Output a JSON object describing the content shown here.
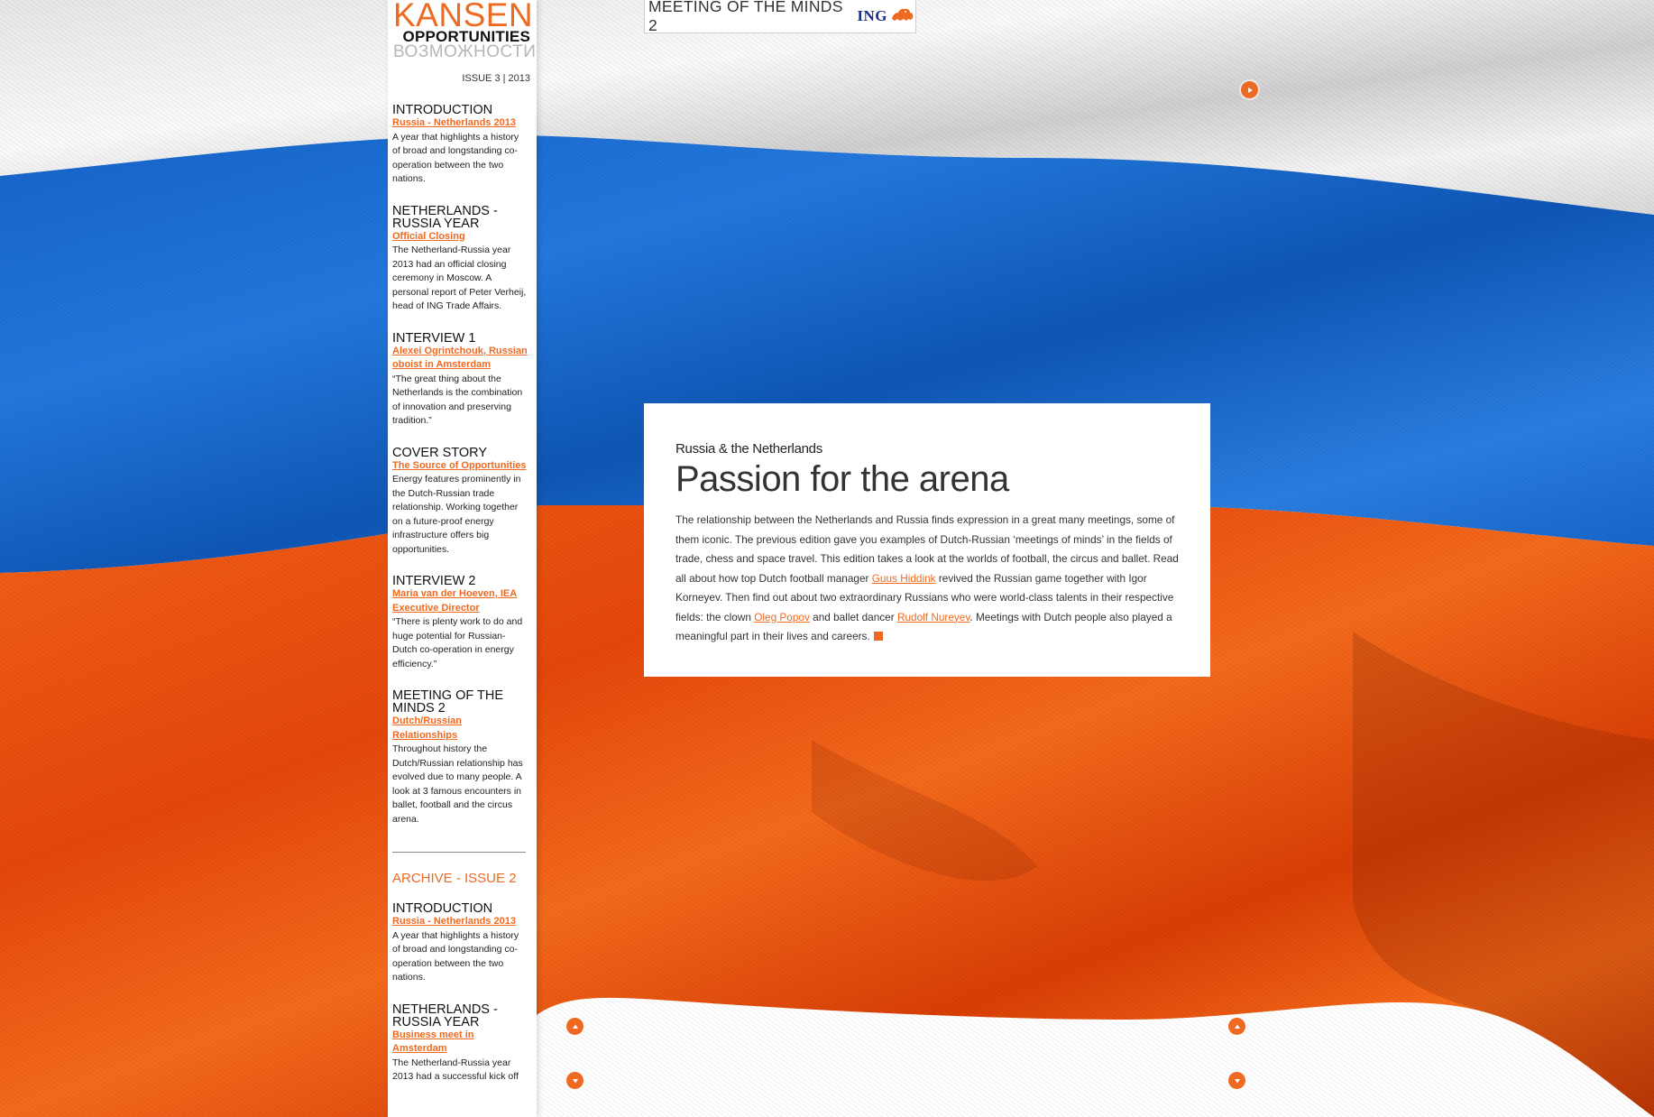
{
  "masthead": {
    "title_nl": "KANSEN",
    "title_en": "OPPORTUNITIES",
    "title_ru": "ВОЗМОЖНОСТИ",
    "issue": "ISSUE 3 | 2013"
  },
  "sidebar": {
    "sections": [
      {
        "heading": "INTRODUCTION",
        "link": "Russia - Netherlands 2013",
        "desc": "A year that highlights a history of broad and longstanding co-operation between the two nations."
      },
      {
        "heading": "NETHERLANDS - RUSSIA YEAR",
        "link": "Official Closing",
        "desc": "The Netherland-Russia year 2013 had an official closing ceremony in Moscow. A personal report of Peter Verheij, head of ING Trade Affairs."
      },
      {
        "heading": "INTERVIEW 1",
        "link": "Alexei Ogrintchouk, Russian oboist in Amsterdam",
        "desc": "“The great thing about the Netherlands is the combination of innovation and preserving tradition.”"
      },
      {
        "heading": "COVER STORY",
        "link": "The Source of Opportunities",
        "desc": "Energy features prominently in the Dutch-Russian trade relationship. Working together on a future-proof energy infrastructure offers big opportunities."
      },
      {
        "heading": "INTERVIEW 2",
        "link": "Maria van der Hoeven, IEA Executive Director",
        "desc": "“There is plenty work to do and huge potential for Russian-Dutch co-operation in energy efficiency.”"
      },
      {
        "heading": "MEETING OF THE MINDS 2",
        "link": "Dutch/Russian Relationships",
        "desc": "Throughout history the Dutch/Russian relationship has evolved due to many people. A look at 3 famous encounters in ballet, football and the circus arena."
      }
    ],
    "archive_heading": "ARCHIVE - ISSUE 2",
    "archive_sections": [
      {
        "heading": "INTRODUCTION",
        "link": "Russia - Netherlands 2013",
        "desc": "A year that highlights a history of broad and longstanding co-operation between the two nations."
      },
      {
        "heading": "NETHERLANDS - RUSSIA YEAR",
        "link": "Business meet in Amsterdam",
        "desc": "The Netherland-Russia year 2013 had a successful kick off"
      }
    ]
  },
  "banner": {
    "title": "MEETING OF THE MINDS 2",
    "brand": "ING",
    "lion_icon": "ing-lion-icon"
  },
  "article": {
    "kicker": "Russia & the Netherlands",
    "title": "Passion for the arena",
    "body_1": "The relationship between the Netherlands and Russia finds expression in a great many meetings, some of them iconic. The previous edition gave you examples of Dutch-Russian ‘meetings of minds’ in the fields of trade, chess and space travel. This edition takes a look at the worlds of football, the circus and ballet. Read all about how top Dutch football manager ",
    "link_1": "Guus Hiddink",
    "body_2": " revived the Russian game together with Igor Korneyev. Then find out about two extraordinary Russians who were world-class talents in their respective fields: the clown ",
    "link_2": "Oleg Popov",
    "body_3": " and ballet dancer ",
    "link_3": "Rudolf Nureyev",
    "body_4": ". Meetings with Dutch people also played a meaningful part in their lives and careers."
  },
  "colors": {
    "accent": "#ee6a22",
    "flag_white": "#f2f2f2",
    "flag_blue": "#1e6fd1",
    "flag_red": "#f15a13",
    "ing_blue": "#1b2f8a"
  },
  "icons": {
    "next": "play-right-icon",
    "up": "arrow-up-icon",
    "down": "arrow-down-icon"
  }
}
